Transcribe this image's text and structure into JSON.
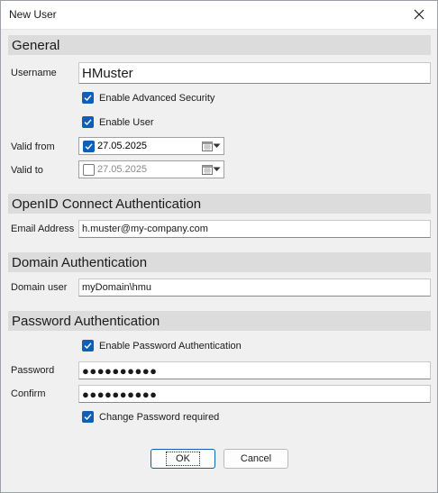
{
  "window": {
    "title": "New User"
  },
  "sections": {
    "general": "General",
    "openid": "OpenID Connect Authentication",
    "domain": "Domain Authentication",
    "password": "Password Authentication"
  },
  "general": {
    "username_label": "Username",
    "username_value": "HMuster",
    "enable_advanced_security": {
      "label": "Enable Advanced Security",
      "checked": true
    },
    "enable_user": {
      "label": "Enable User",
      "checked": true
    },
    "valid_from_label": "Valid from",
    "valid_from_value": "27.05.2025",
    "valid_from_checked": true,
    "valid_to_label": "Valid to",
    "valid_to_value": "27.05.2025",
    "valid_to_checked": false
  },
  "openid": {
    "email_label": "Email Address",
    "email_value": "h.muster@my-company.com"
  },
  "domain": {
    "user_label": "Domain user",
    "user_value": "myDomain\\hmu"
  },
  "password": {
    "enable_password_auth": {
      "label": "Enable Password Authentication",
      "checked": true
    },
    "password_label": "Password",
    "password_value": "●●●●●●●●●●",
    "confirm_label": "Confirm",
    "confirm_value": "●●●●●●●●●●",
    "change_required": {
      "label": "Change Password required",
      "checked": true
    }
  },
  "buttons": {
    "ok": "OK",
    "cancel": "Cancel"
  },
  "colors": {
    "accent": "#0f5fb8",
    "section_bg": "#dcdcdc",
    "dialog_bg": "#f0f0f0"
  }
}
